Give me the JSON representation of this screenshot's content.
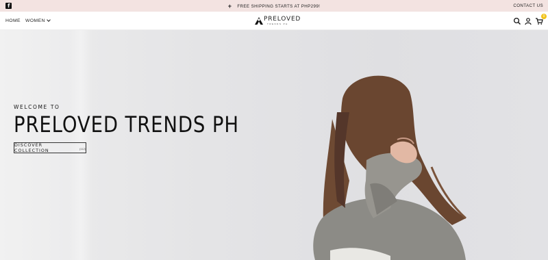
{
  "announcement": {
    "facebook_icon": "facebook-icon",
    "message": "FREE SHIPPING STARTS AT PHP299!",
    "plus_icon": "+",
    "contact_label": "CONTACT US"
  },
  "header": {
    "nav": [
      {
        "label": "HOME"
      },
      {
        "label": "WOMEN",
        "has_dropdown": true
      }
    ],
    "logo": {
      "text": "PRELOVED",
      "subtext": "TRENDS PH"
    },
    "icons": [
      "search-icon",
      "account-icon",
      "cart-icon"
    ],
    "cart_count": "0"
  },
  "hero": {
    "eyebrow": "WELCOME TO",
    "title": "PRELOVED TRENDS PH",
    "cta_label": "DISCOVER COLLECTION",
    "cta_count": "(112)"
  },
  "colors": {
    "announcement_bg": "#f3e3e1",
    "badge": "#f2c318",
    "text": "#111111"
  }
}
